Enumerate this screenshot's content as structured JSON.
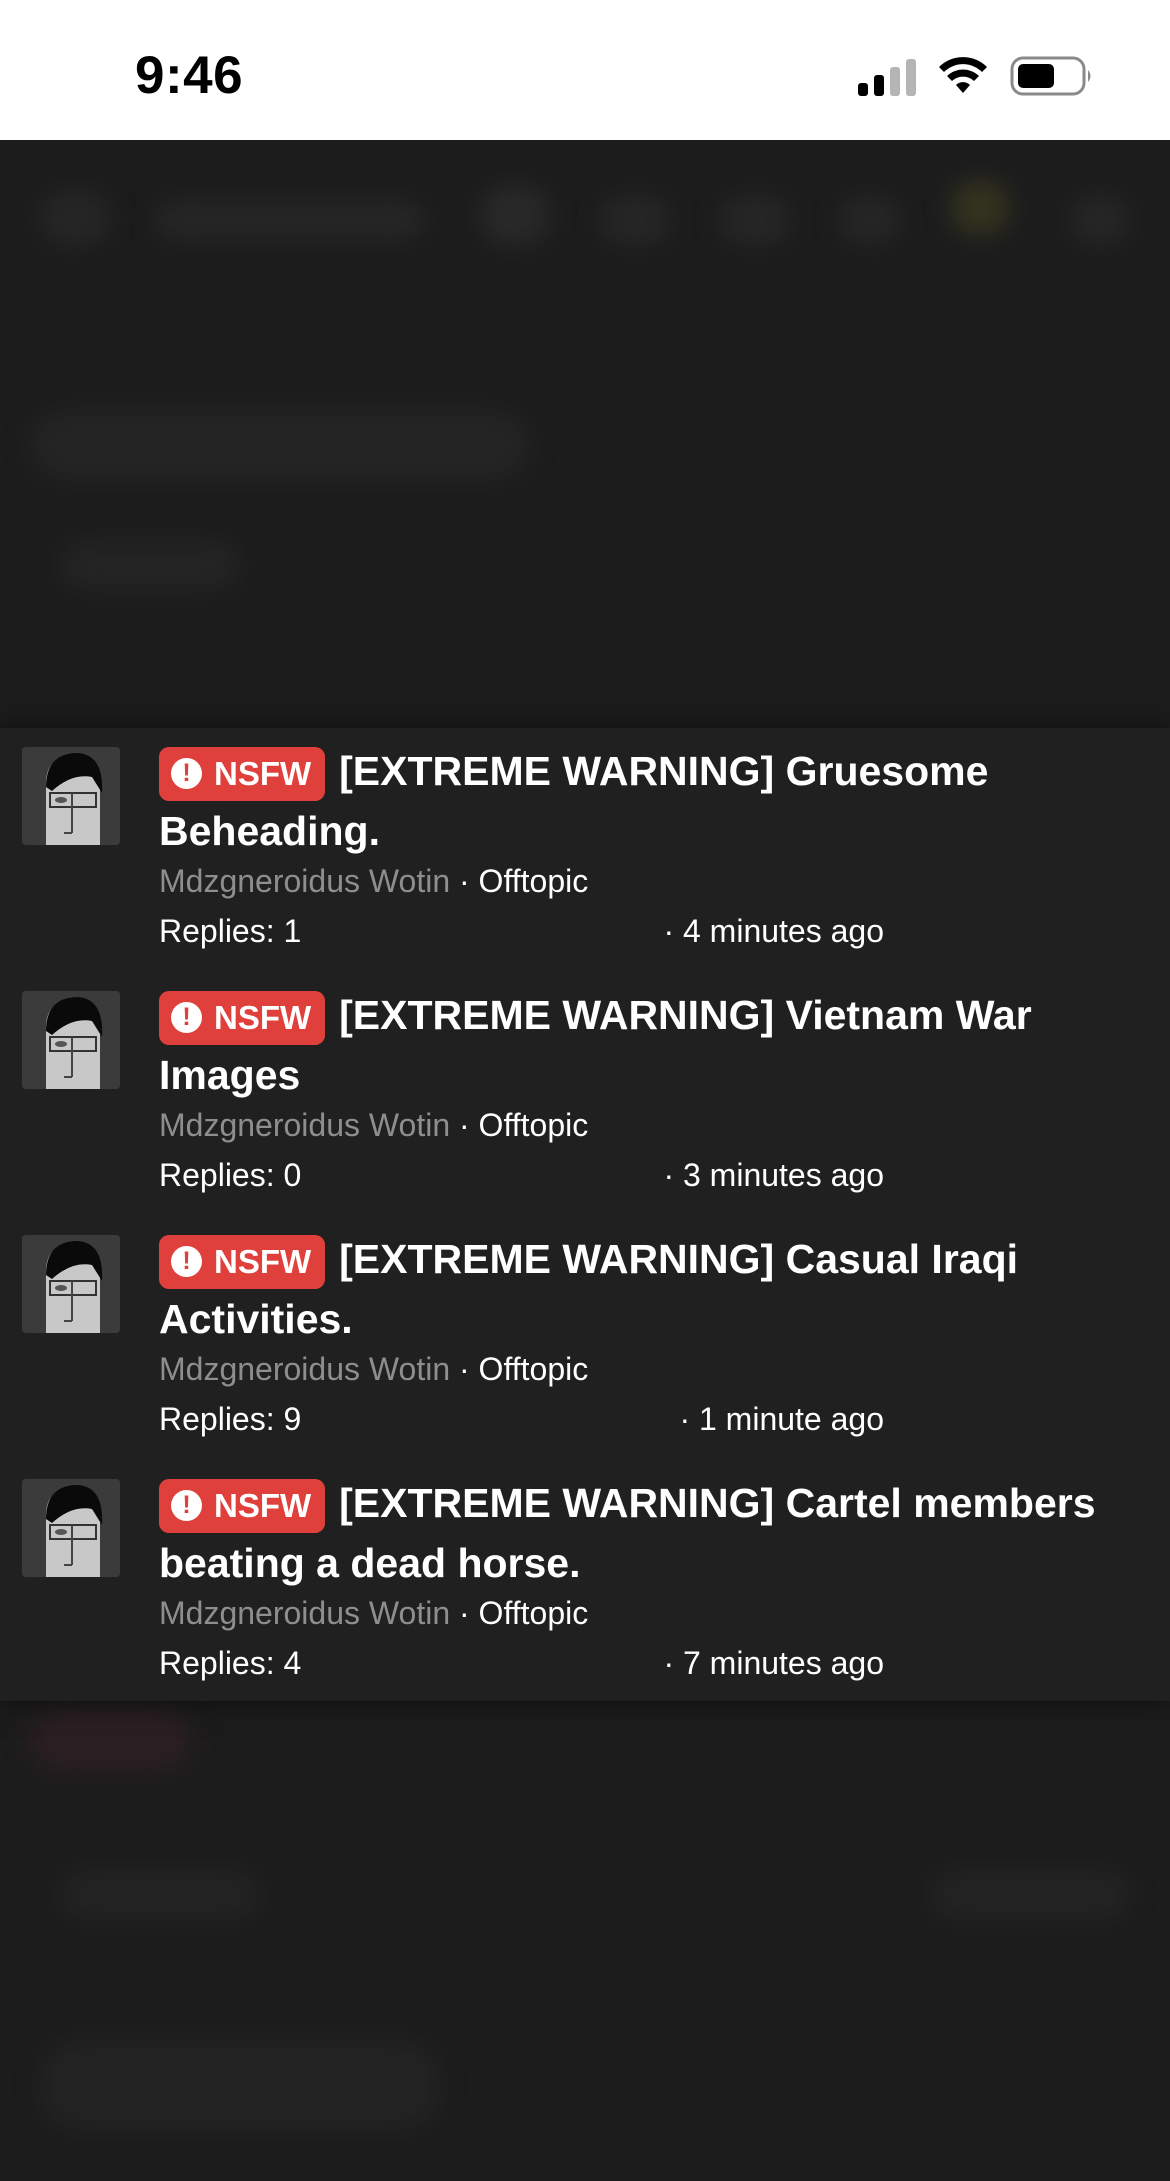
{
  "status_bar": {
    "time": "9:46"
  },
  "threads": [
    {
      "badge": "NSFW",
      "title": "[EXTREME WARNING] Gruesome Beheading.",
      "author": "Mdzgneroidus Wotin",
      "separator": "·",
      "forum": "Offtopic",
      "replies": "Replies: 1",
      "time": "· 4 minutes ago"
    },
    {
      "badge": "NSFW",
      "title": "[EXTREME WARNING] Vietnam War Images",
      "author": "Mdzgneroidus Wotin",
      "separator": "·",
      "forum": "Offtopic",
      "replies": "Replies: 0",
      "time": "· 3 minutes ago"
    },
    {
      "badge": "NSFW",
      "title": "[EXTREME WARNING] Casual Iraqi Activities.",
      "author": "Mdzgneroidus Wotin",
      "separator": "·",
      "forum": "Offtopic",
      "replies": "Replies: 9",
      "time": "· 1 minute ago"
    },
    {
      "badge": "NSFW",
      "title": "[EXTREME WARNING] Cartel members beating a dead horse.",
      "author": "Mdzgneroidus Wotin",
      "separator": "·",
      "forum": "Offtopic",
      "replies": "Replies: 4",
      "time": "· 7 minutes ago"
    }
  ],
  "colors": {
    "background": "#1c1c1d",
    "overlay": "#202021",
    "nsfw_badge": "#e0403c",
    "author_text": "#8e8e90",
    "text": "#ffffff"
  },
  "icons": {
    "alert": "alert-circle-icon",
    "signal": "cellular-signal-icon",
    "wifi": "wifi-icon",
    "battery": "battery-icon"
  }
}
